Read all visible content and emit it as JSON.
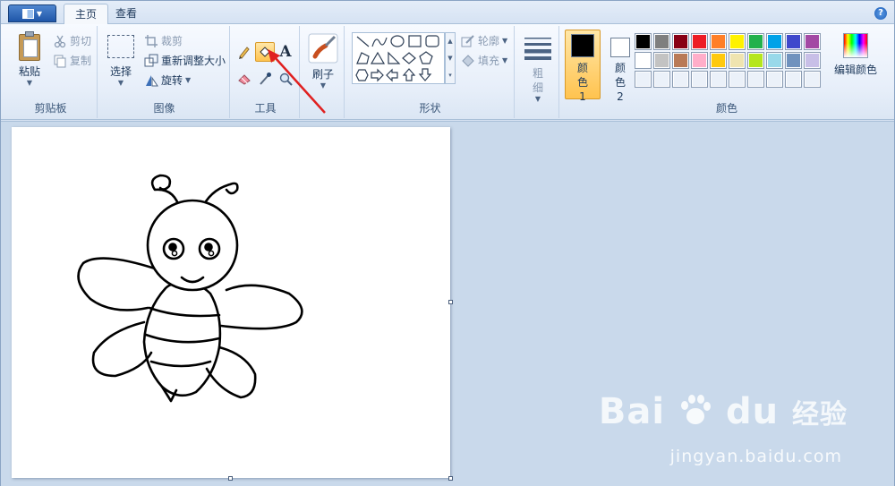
{
  "tabs": [
    {
      "label": "主页",
      "active": true
    },
    {
      "label": "查看",
      "active": false
    }
  ],
  "help": {
    "glyph": "?"
  },
  "clipboard": {
    "group_label": "剪贴板",
    "paste_label": "粘贴",
    "cut_label": "剪切",
    "copy_label": "复制"
  },
  "image": {
    "group_label": "图像",
    "select_label": "选择",
    "crop_label": "裁剪",
    "resize_label": "重新调整大小",
    "rotate_label": "旋转"
  },
  "tools": {
    "group_label": "工具",
    "items": [
      "pencil-icon",
      "fill-bucket-icon",
      "text-icon",
      "eraser-icon",
      "color-picker-icon",
      "magnifier-icon"
    ],
    "active": "fill-bucket-icon",
    "text_glyph": "A"
  },
  "brushes": {
    "label": "刷子"
  },
  "shapes": {
    "group_label": "形状",
    "outline_label": "轮廓",
    "fill_label": "填充"
  },
  "size": {
    "label": "粗细"
  },
  "colors": {
    "group_label": "颜色",
    "color1_label": "颜色 1",
    "color2_label": "颜色 2",
    "color1_value": "#000000",
    "color2_value": "#ffffff",
    "edit_label": "编辑颜色",
    "palette_row1": [
      "#000000",
      "#7f7f7f",
      "#880015",
      "#ed1c24",
      "#ff7f27",
      "#fff200",
      "#22b14c",
      "#00a2e8",
      "#3f48cc",
      "#a349a4"
    ],
    "palette_row2": [
      "#ffffff",
      "#c3c3c3",
      "#b97a57",
      "#ffaec9",
      "#ffc90e",
      "#efe4b0",
      "#b5e61d",
      "#99d9ea",
      "#7092be",
      "#c8bfe7"
    ]
  },
  "watermark": {
    "brand": "Bai",
    "brand2": "du",
    "brand_cn": "经验",
    "url": "jingyan.baidu.com"
  }
}
